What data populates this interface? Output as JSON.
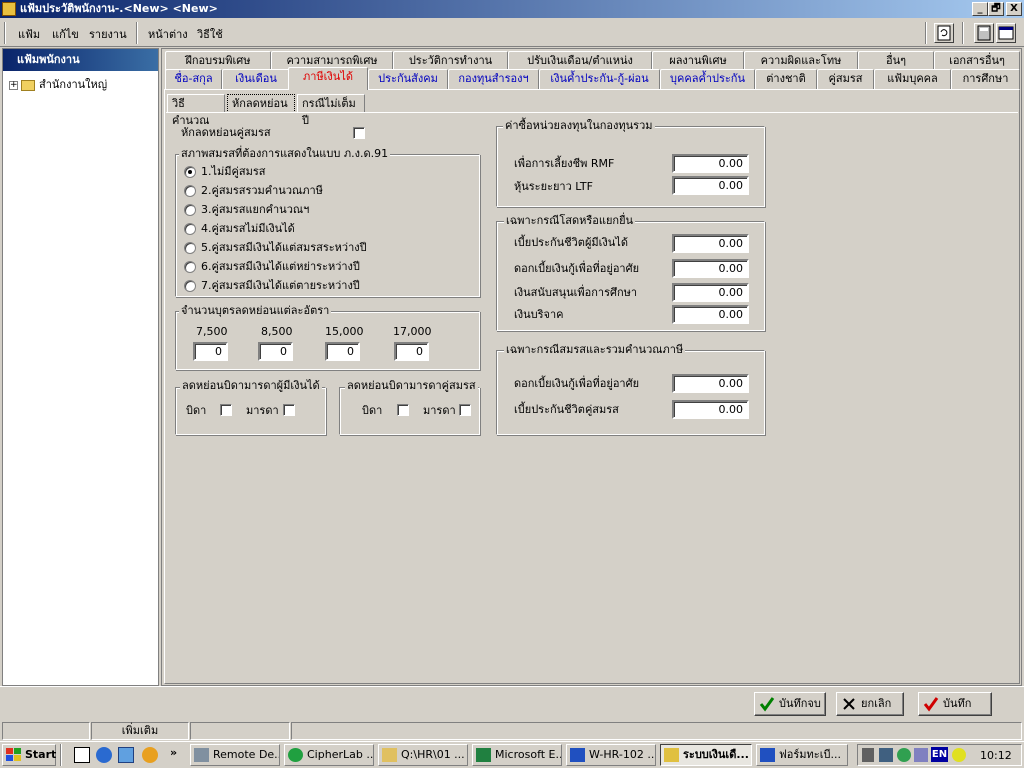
{
  "window": {
    "title": "แฟ้มประวัติพนักงาน-.<New> <New>",
    "min": "_",
    "max": "🗗",
    "close": "X"
  },
  "menu": [
    "แฟ้ม",
    "แก้ไข",
    "รายงาน",
    "หน้าต่าง",
    "วิธีใช้"
  ],
  "left_panel": {
    "header": "แฟ้มพนักงาน",
    "tree_item": "สำนักงานใหญ่",
    "expand": "+"
  },
  "tabs_row1": [
    "ฝึกอบรมพิเศษ",
    "ความสามารถพิเศษ",
    "ประวัติการทำงาน",
    "ปรับเงินเดือน/ตำแหน่ง",
    "ผลงานพิเศษ",
    "ความผิดและโทษ",
    "อื่นๆ",
    "เอกสารอื่นๆ"
  ],
  "tabs_row2": [
    "ชื่อ-สกุล",
    "เงินเดือน",
    "ภาษีเงินได้",
    "ประกันสังคม",
    "กองทุนสำรองฯ",
    "เงินค้ำประกัน-กู้-ผ่อน",
    "บุคคลค้ำประกัน",
    "ต่างชาติ",
    "คู่สมรส",
    "แฟ้มบุคคล",
    "การศึกษา"
  ],
  "subtabs": [
    "วิธีคำนวณ",
    "หักลดหย่อน",
    "กรณีไม่เต็มปี"
  ],
  "deduct_spouse": "หักลดหย่อนคู่สมรส",
  "marital": {
    "legend": "สภาพสมรสที่ต้องการแสดงในแบบ ภ.ง.ด.91",
    "options": [
      "1.ไม่มีคู่สมรส",
      "2.คู่สมรสรวมคำนวณภาษี",
      "3.คู่สมรสแยกคำนวณฯ",
      "4.คู่สมรสไม่มีเงินได้",
      "5.คู่สมรสมีเงินได้แต่สมรสระหว่างปี",
      "6.คู่สมรสมีเงินได้แต่หย่าระหว่างปี",
      "7.คู่สมรสมีเงินได้แต่ตายระหว่างปี"
    ],
    "selected": 0
  },
  "children": {
    "legend": "จำนวนบุตรลดหย่อนแต่ละอัตรา",
    "rates": [
      "7,500",
      "8,500",
      "15,000",
      "17,000"
    ],
    "values": [
      "0",
      "0",
      "0",
      "0"
    ]
  },
  "parents_self": {
    "legend": "ลดหย่อนบิดามารดาผู้มีเงินได้",
    "father": "บิดา",
    "mother": "มารดา"
  },
  "parents_spouse": {
    "legend": "ลดหย่อนบิดามารดาคู่สมรส",
    "father": "บิดา",
    "mother": "มารดา"
  },
  "funds": {
    "legend": "ค่าซื้อหน่วยลงทุนในกองทุนรวม",
    "rows": [
      {
        "label": "เพื่อการเลี้ยงชีพ RMF",
        "value": "0.00"
      },
      {
        "label": "หุ้นระยะยาว LTF",
        "value": "0.00"
      }
    ]
  },
  "single": {
    "legend": "เฉพาะกรณีโสดหรือแยกยื่น",
    "rows": [
      {
        "label": "เบี้ยประกันชีวิตผู้มีเงินได้",
        "value": "0.00"
      },
      {
        "label": "ดอกเบี้ยเงินกู้เพื่อที่อยู่อาศัย",
        "value": "0.00"
      },
      {
        "label": "เงินสนับสนุนเพื่อการศึกษา",
        "value": "0.00"
      },
      {
        "label": "เงินบริจาค",
        "value": "0.00"
      }
    ]
  },
  "married": {
    "legend": "เฉพาะกรณีสมรสและรวมคำนวณภาษี",
    "rows": [
      {
        "label": "ดอกเบี้ยเงินกู้เพื่อที่อยู่อาศัย",
        "value": "0.00"
      },
      {
        "label": "เบี้ยประกันชีวิตคู่สมรส",
        "value": "0.00"
      }
    ]
  },
  "actions": {
    "save_close": "บันทึกจบ",
    "cancel": "ยกเลิก",
    "save": "บันทึก"
  },
  "status": {
    "mode": "เพิ่มเติม"
  },
  "taskbar": {
    "start": "Start",
    "arrows": "»",
    "tasks": [
      "Remote De...",
      "CipherLab ...",
      "Q:\\HR\\01 ...",
      "Microsoft E...",
      "W-HR-102 ...",
      "ระบบเงินเดื...",
      "ฟอร์มทะเบี..."
    ],
    "lang": "EN",
    "clock": "10:12"
  },
  "colors": {
    "title_start": "#0a246a",
    "active_tab": "#e00000",
    "blue_tab": "#0000c0",
    "face": "#d4d0c8"
  }
}
